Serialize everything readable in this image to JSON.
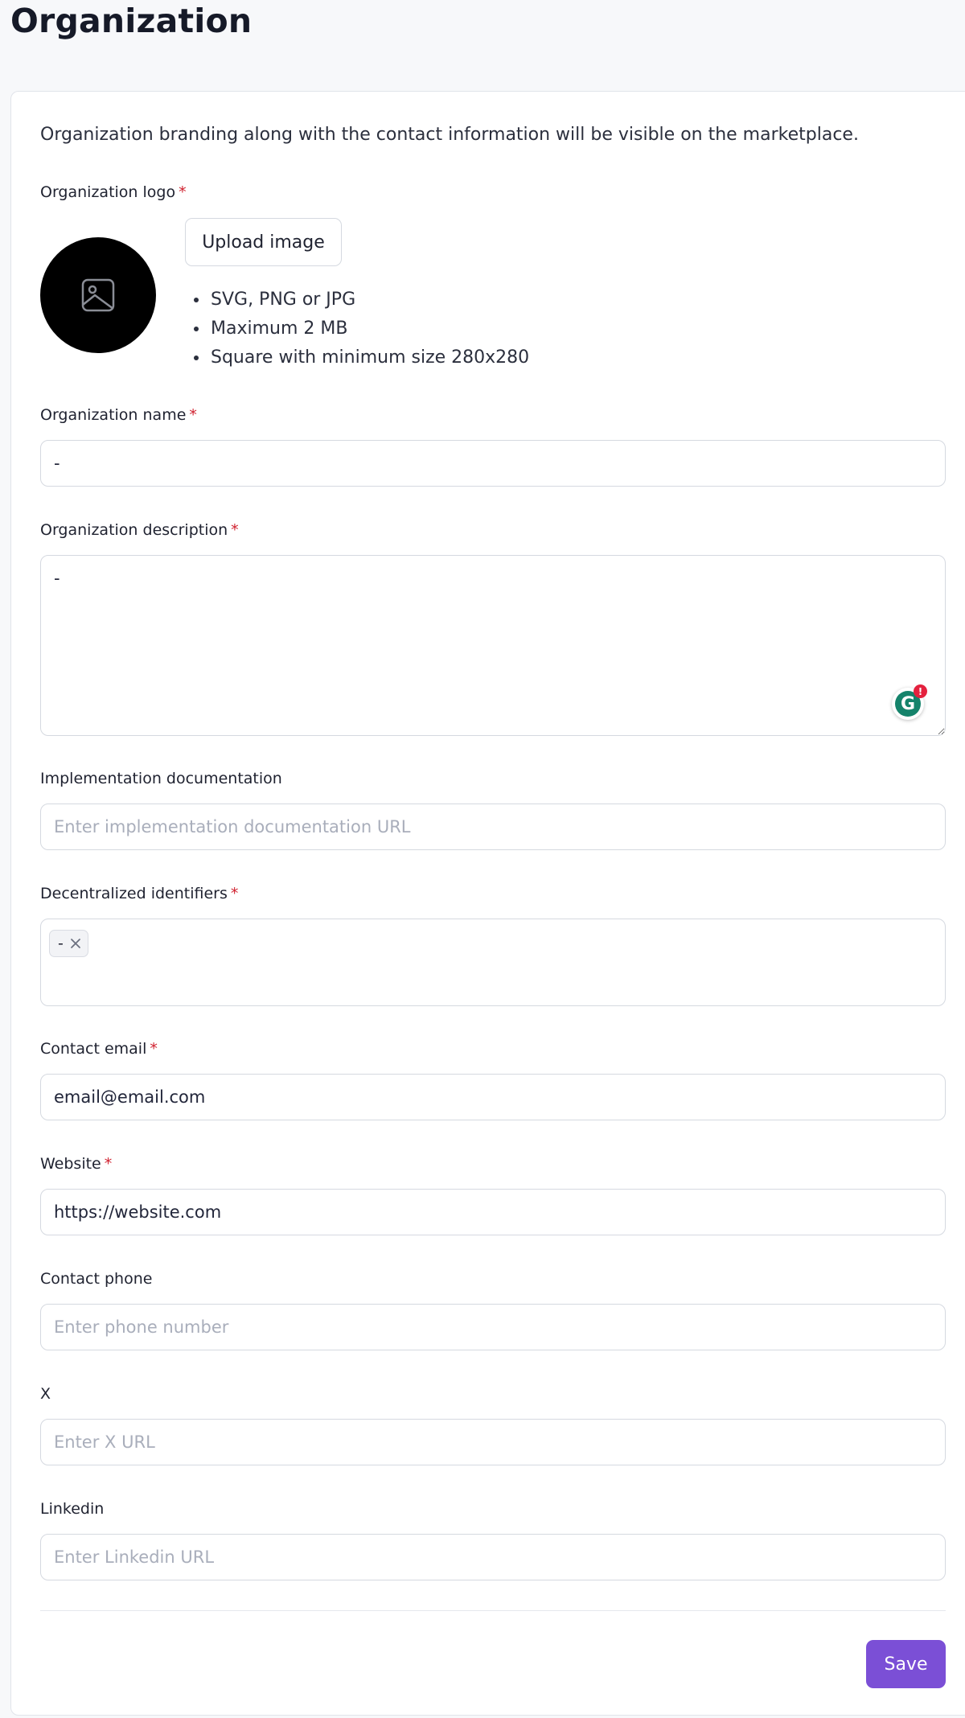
{
  "page": {
    "title": "Organization",
    "intro": "Organization branding along with the contact information will be visible on the marketplace."
  },
  "logo": {
    "label": "Organization logo",
    "required_mark": "*",
    "placeholder_icon": "image-icon",
    "upload_label": "Upload image",
    "hints": [
      "SVG, PNG or JPG",
      "Maximum 2 MB",
      "Square with minimum size 280x280"
    ]
  },
  "fields": {
    "name": {
      "label": "Organization name",
      "required_mark": "*",
      "value": "-"
    },
    "description": {
      "label": "Organization description",
      "required_mark": "*",
      "value": "-"
    },
    "docs": {
      "label": "Implementation documentation",
      "value": "",
      "placeholder": "Enter implementation documentation URL"
    },
    "dids": {
      "label": "Decentralized identifiers",
      "required_mark": "*",
      "tags": [
        "-"
      ]
    },
    "email": {
      "label": "Contact email",
      "required_mark": "*",
      "value": "email@email.com"
    },
    "website": {
      "label": "Website",
      "required_mark": "*",
      "value": "https://website.com"
    },
    "phone": {
      "label": "Contact phone",
      "value": "",
      "placeholder": "Enter phone number"
    },
    "x": {
      "label": "X",
      "value": "",
      "placeholder": "Enter X URL"
    },
    "linkedin": {
      "label": "Linkedin",
      "value": "",
      "placeholder": "Enter Linkedin URL"
    }
  },
  "grammarly": {
    "icon": "grammarly-icon",
    "letter": "G",
    "badge": "!"
  },
  "actions": {
    "save_label": "Save"
  },
  "colors": {
    "accent": "#7b4fd6",
    "required": "#d0212f",
    "grammarly": "#15836b"
  }
}
